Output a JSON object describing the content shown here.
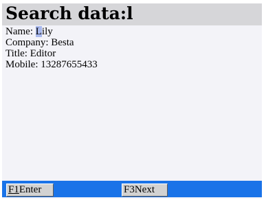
{
  "title": "Search data:l",
  "fields": [
    {
      "label": "Name:",
      "value_cursor": "L",
      "value_rest": "ily"
    },
    {
      "label": "Company:",
      "value": "Besta"
    },
    {
      "label": "Title:",
      "value": "Editor"
    },
    {
      "label": "Mobile:",
      "value": "13287655433"
    }
  ],
  "softkeys": {
    "f1": {
      "key": "F1",
      "label": "Enter"
    },
    "f3": {
      "key": "F3",
      "label": "Next"
    }
  },
  "colors": {
    "title_bar": "#d6d6d9",
    "background": "#f3f3f8",
    "bottom_bar": "#1a73e8",
    "cursor": "#a9b9ee",
    "softkey": "#d2d2d2"
  }
}
